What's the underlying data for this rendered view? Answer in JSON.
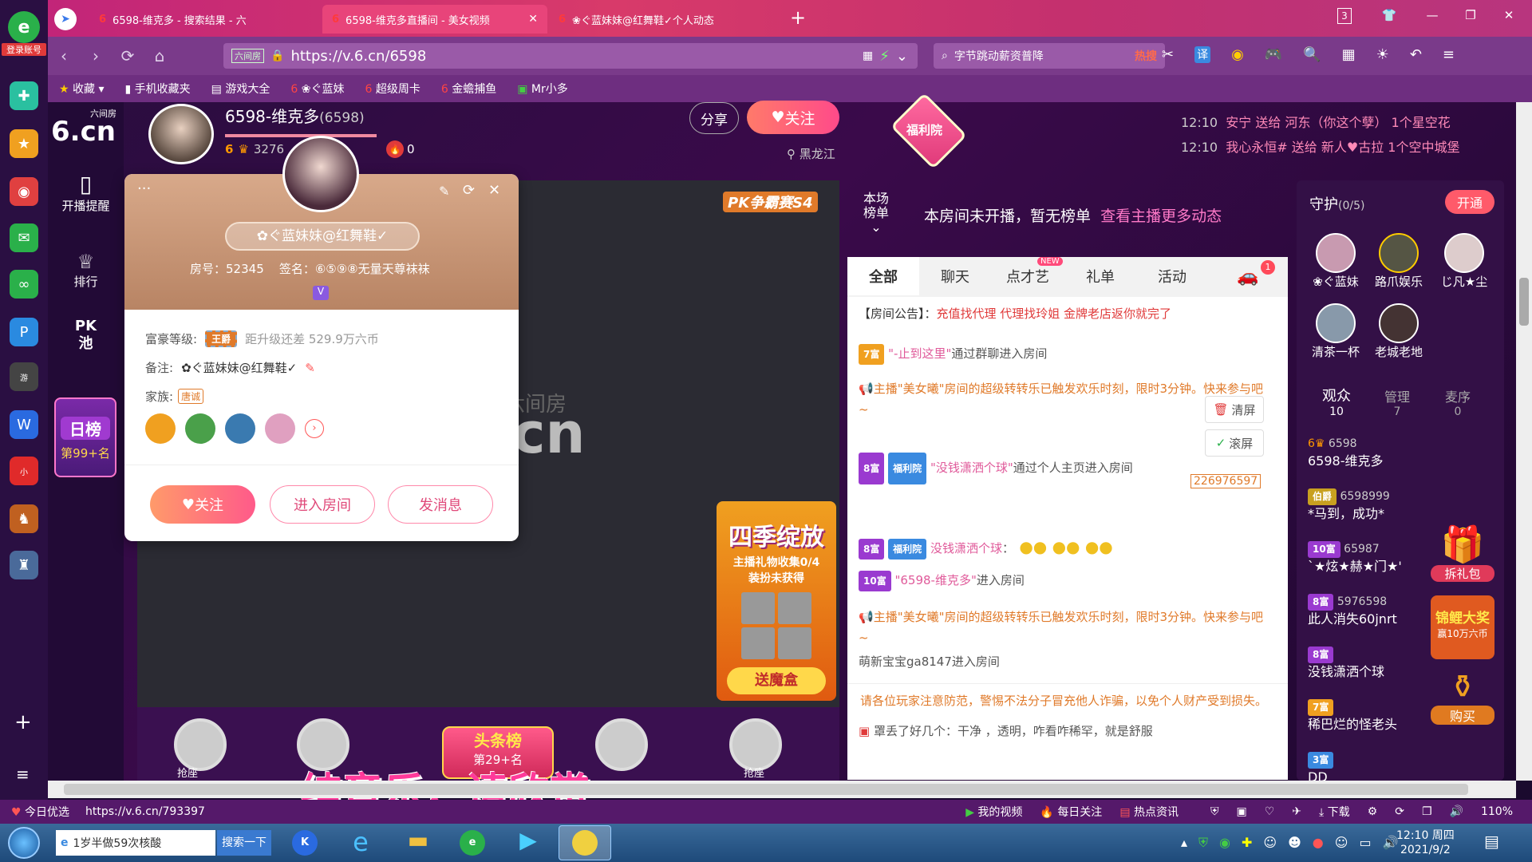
{
  "browser": {
    "tabs": [
      {
        "label": "6598-维克多 - 搜索结果 - 六"
      },
      {
        "label": "6598-维克多直播间 - 美女视频"
      },
      {
        "label": "❀ぐ蓝妹妹@红舞鞋✓个人动态"
      }
    ],
    "tab_count": "3",
    "url": "https://v.6.cn/6598",
    "url_tag": "六间房",
    "search_text": "字节跳动薪资普降",
    "hot_label": "热搜",
    "translate_label": "译",
    "login_label": "登录账号"
  },
  "bookmarks": [
    {
      "label": "收藏"
    },
    {
      "label": "手机收藏夹"
    },
    {
      "label": "游戏大全"
    },
    {
      "label": "❀ぐ蓝妹"
    },
    {
      "label": "超级周卡"
    },
    {
      "label": "金蟾捕鱼"
    },
    {
      "label": "Mr小多"
    }
  ],
  "site": {
    "logo_top": "六间房",
    "logo": "6.cn",
    "sidenav": [
      {
        "label": "开播提醒"
      },
      {
        "label": "排行"
      },
      {
        "label": "PK池"
      }
    ],
    "daily_rank_title": "日榜",
    "daily_rank_value": "第99+名"
  },
  "streamer": {
    "name": "6598-维克多",
    "room_id": "(6598)",
    "level": "6",
    "fans": "3276",
    "heat": "0",
    "share_label": "分享",
    "follow_label": "关注",
    "location": "黑龙江",
    "welfare_label": "福利院"
  },
  "ticker": [
    {
      "time": "12:10",
      "text": "安宁 送给 河东（你这个孽） 1个星空花"
    },
    {
      "time": "12:10",
      "text": "我心永恒# 送给 新人♥古拉 1个空中城堡"
    }
  ],
  "rank_bar": {
    "label1": "本场",
    "label2": "榜单",
    "message": "本房间未开播，暂无榜单",
    "link": "查看主播更多动态"
  },
  "chat_tabs": [
    {
      "label": "全部"
    },
    {
      "label": "聊天"
    },
    {
      "label": "点才艺",
      "badge": "NEW"
    },
    {
      "label": "礼单"
    },
    {
      "label": "活动"
    }
  ],
  "car_badge": "1",
  "chat": {
    "announce_prefix": "【房间公告】：",
    "announce": "充值找代理 代理找玲姐 金牌老店返你就完了",
    "clear_label": "清屏",
    "scroll_label": "滚屏",
    "car_id": "226976597",
    "lines": [
      {
        "badge": "7富",
        "name": "\"-止到这里\"",
        "text": "通过群聊进入房间"
      },
      {
        "text": "主播\"美女曦\"房间的超级转转乐已触发欢乐时刻，限时3分钟。快来参与吧~"
      },
      {
        "badge": "8富",
        "tag": "福利院",
        "name": "\"没钱潇洒个球\"",
        "text": "通过个人主页进入房间"
      },
      {
        "badge": "8富",
        "tag": "福利院",
        "name": "没钱潇洒个球",
        "text": "："
      },
      {
        "badge": "10富",
        "name": "\"6598-维克多\"",
        "text": "进入房间"
      },
      {
        "text": "主播\"美女曦\"房间的超级转转乐已触发欢乐时刻，限时3分钟。快来参与吧~"
      },
      {
        "text": "萌新宝宝ga8147进入房间"
      }
    ],
    "warning": "请各位玩家注意防范，警惕不法分子冒充他人诈骗，以免个人财产受到损失。",
    "bottom_line": "罩丢了好几个：干净 ，透明，咋看咋稀罕，就是舒服"
  },
  "guard": {
    "title": "守护",
    "count": "(0/5)",
    "open_label": "开通",
    "members": [
      {
        "name": "❀ぐ蓝妹"
      },
      {
        "name": "路爪娱乐"
      },
      {
        "name": "じ凡★尘"
      },
      {
        "name": "清茶一杯"
      },
      {
        "name": "老城老地"
      }
    ],
    "tabs": [
      {
        "label": "观众",
        "count": "10"
      },
      {
        "label": "管理",
        "count": "7"
      },
      {
        "label": "麦序",
        "count": "0"
      }
    ],
    "audience": [
      {
        "id": "6598",
        "name": "6598-维克多"
      },
      {
        "badge": "伯爵",
        "id": "6598999",
        "name": "*马到，成功*"
      },
      {
        "badge": "10富",
        "id": "65987",
        "name": "`★炫★赫★门★'"
      },
      {
        "badge": "8富",
        "id": "5976598",
        "name": "此人消失60jnrt"
      },
      {
        "badge": "8富",
        "name": "没钱潇洒个球"
      },
      {
        "badge": "7富",
        "name": "稀巴烂的怪老头"
      },
      {
        "badge": "3富",
        "name": "DD"
      }
    ],
    "gift_pack_label": "拆礼包",
    "koi_label": "锦鲤大奖",
    "koi_sub": "赢10万六币",
    "buy_label": "购买"
  },
  "video": {
    "pk_label": "PK争霸赛S4",
    "season_title": "四季绽放",
    "season_task": "主播礼物收集0/4",
    "season_sub": "装扮未获得",
    "season_btn": "送魔盒",
    "headline_title": "头条榜",
    "headline_rank": "第29+名",
    "seat_label": "抢座",
    "watermark": "六间房",
    "subtitle": "纯音乐，请欣赏"
  },
  "card": {
    "nickname": "✿ぐ蓝妹妹@红舞鞋✓",
    "room_prefix": "房号：",
    "room_no": "52345",
    "sign_prefix": "签名：",
    "sign": "⑥⑤⑨⑧无量天尊袜袜",
    "wealth_label": "富豪等级:",
    "wealth_badge": "王爵",
    "wealth_gap": "距升级还差 529.9万六币",
    "note_label": "备注:",
    "note_value": "✿ぐ蓝妹妹@红舞鞋✓",
    "family_label": "家族:",
    "family_value": "唐诚",
    "follow_label": "关注",
    "enter_label": "进入房间",
    "message_label": "发消息",
    "more": "···"
  },
  "statusbar": {
    "today": "今日优选",
    "url": "https://v.6.cn/793397",
    "my_video": "我的视频",
    "daily_follow": "每日关注",
    "hot_news": "热点资讯",
    "download": "下载",
    "zoom": "110%"
  },
  "taskbar": {
    "ie_text": "1岁半做59次核酸",
    "search_btn": "搜索一下",
    "time": "12:10 周四",
    "date": "2021/9/2"
  }
}
